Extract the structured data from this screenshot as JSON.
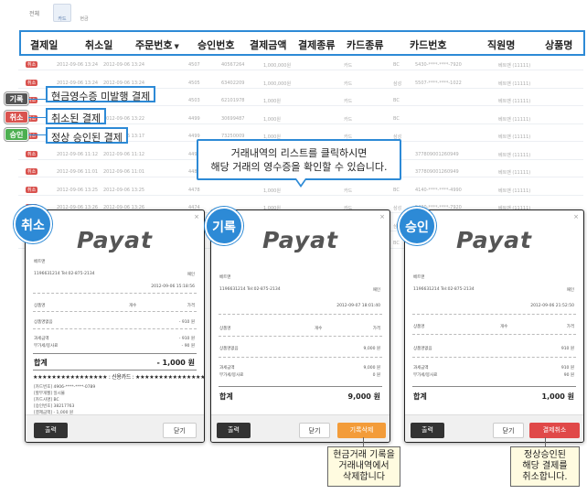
{
  "filter": {
    "label": "전체",
    "btn1": "카드",
    "btn2": "현금"
  },
  "table": {
    "headers": [
      "결제일",
      "취소일",
      "주문번호",
      "승인번호",
      "결제금액",
      "결제종류",
      "카드종류",
      "카드번호",
      "직원명",
      "상품명"
    ],
    "sort_indicator": "▼",
    "rows": [
      {
        "tag": "취소",
        "tagtype": "cancel",
        "paid": "2012-09-06 13:24",
        "cancel": "2012-09-06 13:24",
        "order": "4507",
        "approval": "40567264",
        "amount": "1,000,000원",
        "type": "카드",
        "ctype": "BC",
        "cno": "5430-****-****-7920",
        "staff": "베트맨 (11111)"
      },
      {
        "tag": "취소",
        "tagtype": "cancel",
        "paid": "2012-09-06 13:24",
        "cancel": "2012-09-06 13:24",
        "order": "4505",
        "approval": "63402209",
        "amount": "1,000,000원",
        "type": "카드",
        "ctype": "삼성",
        "cno": "5507-****-****-1022",
        "staff": "베트맨 (11111)"
      },
      {
        "tag": "취소",
        "tagtype": "cancel",
        "paid": "2012-09-06 13:24",
        "cancel": "2012-09-06 13:24",
        "order": "4503",
        "approval": "62101978",
        "amount": "1,000원",
        "type": "카드",
        "ctype": "BC",
        "cno": "",
        "staff": "베트맨 (11111)"
      },
      {
        "tag": "취소",
        "tagtype": "cancel",
        "paid": "2012-09-06 13:22",
        "cancel": "2012-09-06 13:22",
        "order": "4499",
        "approval": "30699487",
        "amount": "1,000원",
        "type": "카드",
        "ctype": "BC",
        "cno": "",
        "staff": "베트맨 (11111)"
      },
      {
        "tag": "취소",
        "tagtype": "cancel",
        "paid": "2012-09-06 13:17",
        "cancel": "2012-09-06 13:17",
        "order": "4499",
        "approval": "73250009",
        "amount": "1,000원",
        "type": "카드",
        "ctype": "삼성",
        "cno": "",
        "staff": "베트맨 (11111)"
      },
      {
        "tag": "취소",
        "tagtype": "cancel",
        "paid": "2012-09-06 11:12",
        "cancel": "2012-09-06 11:12",
        "order": "4496",
        "approval": "12847009",
        "amount": "1,000원",
        "type": "카드",
        "ctype": "삼성",
        "cno": "377809001260949",
        "staff": "베트맨 (11111)"
      },
      {
        "tag": "취소",
        "tagtype": "cancel",
        "paid": "2012-09-06 11:01",
        "cancel": "2012-09-06 11:01",
        "order": "4481",
        "approval": "",
        "amount": "1,000원",
        "type": "카드",
        "ctype": "삼성",
        "cno": "377809001260949",
        "staff": "베트맨 (11111)"
      },
      {
        "tag": "취소",
        "tagtype": "cancel",
        "paid": "2012-09-06 13:25",
        "cancel": "2012-09-06 13:25",
        "order": "4478",
        "approval": "",
        "amount": "1,000원",
        "type": "카드",
        "ctype": "BC",
        "cno": "4140-****-****-4990",
        "staff": "베트맨 (11111)"
      },
      {
        "tag": "취소",
        "tagtype": "cancel",
        "paid": "2012-09-06 13:26",
        "cancel": "2012-09-06 13:26",
        "order": "4474",
        "approval": "",
        "amount": "1,000원",
        "type": "카드",
        "ctype": "삼성",
        "cno": "5430-****-****-7920",
        "staff": "베트맨 (11111)"
      },
      {
        "tag": "취소",
        "tagtype": "cancel",
        "paid": "2012-09-06 13:25",
        "cancel": "2012-09-06 13:25",
        "order": "4505",
        "approval": "",
        "amount": "1,000,000원",
        "type": "카드",
        "ctype": "삼성",
        "cno": "5507-****-****-1022",
        "staff": "베트맨 (11111)"
      },
      {
        "tag": "취소",
        "tagtype": "cancel",
        "paid": "2012-09-06 13:21",
        "cancel": "2012-09-06 13:21",
        "order": "4509",
        "approval": "",
        "amount": "1,000원",
        "type": "카드",
        "ctype": "BC",
        "cno": "",
        "staff": "베트맨 (11111)"
      }
    ]
  },
  "legend": [
    {
      "chip": "기록",
      "color": "#555555",
      "text": "현금영수증 미발행 결제"
    },
    {
      "chip": "취소",
      "color": "#d9534f",
      "text": "취소된 결제"
    },
    {
      "chip": "승인",
      "color": "#4caf50",
      "text": "정상 승인된 결제"
    }
  ],
  "tooltip": {
    "line1": "거래내역의 리스트를 클릭하시면",
    "line2": "해당 거래의 영수증을 확인할 수 있습니다."
  },
  "cards": [
    {
      "badge": "취소",
      "logo": "Payat",
      "close": "×",
      "store": "베트맨",
      "bizline": "1196631214 Tel:02-875-2134",
      "staff_tag": "패인",
      "date": "2012-09-06 15:18:56",
      "col1": "상품명",
      "col2": "개수",
      "col3": "가격",
      "item": "상품명없음",
      "item_qty": "",
      "item_price": "- 910 원",
      "tax1": "과세금액",
      "tax1_val": "- 910 원",
      "tax2": "부가세/봉사료",
      "tax2_val": "- 90 원",
      "total_label": "합계",
      "total": "- 1,000 원",
      "stars": "★★★★★★★★★★★★★★★★ : 신용카드 : ★★★★★★★★★★★★★★★★",
      "info1": "[카드번호] 4906-****-****-0789",
      "info2": "[할부개월] 일시불",
      "info3": "[카드사명] BC",
      "info4": "[승인번호] 38217763",
      "info5": "[결제금액] - 1,000 원",
      "btn_print": "출력",
      "btn_close": "닫기",
      "btn_action": ""
    },
    {
      "badge": "기록",
      "logo": "Payat",
      "close": "×",
      "store": "베트맨",
      "bizline": "1196631214 Tel:02-875-2134",
      "staff_tag": "패인",
      "date": "2012-09-07 18:01:40",
      "col1": "상품명",
      "col2": "개수",
      "col3": "가격",
      "item": "상품명없음",
      "item_qty": "",
      "item_price": "9,000 원",
      "tax1": "과세금액",
      "tax1_val": "9,000 원",
      "tax2": "부가세/봉사료",
      "tax2_val": "0 원",
      "total_label": "합계",
      "total": "9,000 원",
      "stars": "",
      "btn_print": "출력",
      "btn_close": "닫기",
      "btn_action": "기록삭제"
    },
    {
      "badge": "승인",
      "logo": "Payat",
      "close": "×",
      "store": "베트맨",
      "bizline": "1196631214 Tel:02-875-2134",
      "staff_tag": "패인",
      "date": "2012-09-06 21:52:50",
      "col1": "상품명",
      "col2": "개수",
      "col3": "가격",
      "item": "상품명없음",
      "item_qty": "",
      "item_price": "910 원",
      "tax1": "과세금액",
      "tax1_val": "910 원",
      "tax2": "부가세/봉사료",
      "tax2_val": "90 원",
      "total_label": "합계",
      "total": "1,000 원",
      "stars": "",
      "btn_print": "출력",
      "btn_close": "닫기",
      "btn_action": "결제취소"
    }
  ],
  "callouts": {
    "record": "현금거래 기록을\n거래내역에서\n삭제합니다",
    "cancel": "정상승인된\n해당 결제를\n취소합니다."
  }
}
